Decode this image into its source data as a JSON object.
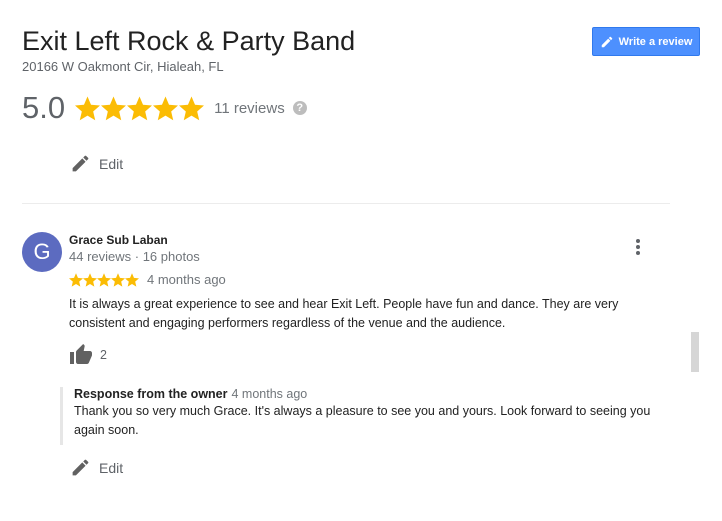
{
  "business": {
    "name": "Exit Left Rock & Party Band",
    "address": "20166 W Oakmont Cir, Hialeah, FL"
  },
  "write_review_label": "Write a review",
  "rating": {
    "value": "5.0",
    "stars": 5,
    "reviews_count": "11 reviews",
    "help_icon_glyph": "?"
  },
  "edit_label": "Edit",
  "review": {
    "avatar_initial": "G",
    "avatar_color": "#5c6bc0",
    "reviewer_name": "Grace Sub Laban",
    "reviewer_meta": "44 reviews · 16 photos",
    "stars": 5,
    "date": "4 months ago",
    "text": "It is always a great experience to see and hear Exit Left. People have fun and dance. They are very consistent and engaging performers regardless of the venue and the audience.",
    "likes": "2",
    "owner_response": {
      "title": "Response from the owner",
      "date": "4 months ago",
      "text": "Thank you so very much Grace. It's always a pleasure to see you and yours. Look forward to seeing you again soon."
    }
  },
  "colors": {
    "star": "#fbbc04",
    "button": "#4d90fe",
    "avatar": "#5c6bc0"
  },
  "icons": {
    "edit": "pencil-icon",
    "like": "thumbs-up-icon",
    "more": "more-vert-icon",
    "help": "help-icon",
    "write": "pencil-icon"
  }
}
